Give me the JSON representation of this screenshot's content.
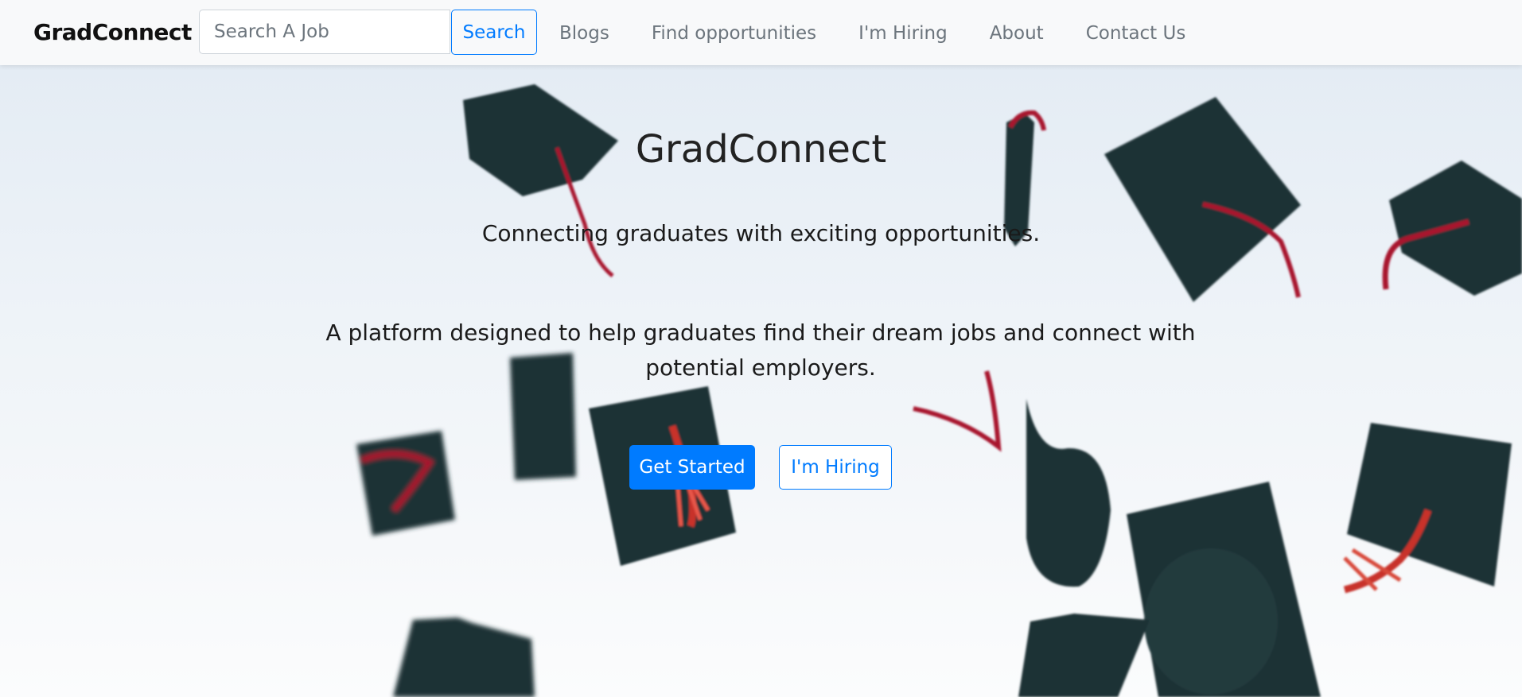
{
  "navbar": {
    "brand": "GradConnect",
    "search_placeholder": "Search A Job",
    "search_button_label": "Search",
    "links": [
      "Blogs",
      "Find opportunities",
      "I'm Hiring",
      "About",
      "Contact Us"
    ]
  },
  "hero": {
    "title": "GradConnect",
    "tagline": "Connecting graduates with exciting opportunities.",
    "description": "A platform designed to help graduates find their dream jobs and connect with potential employers.",
    "primary_button_label": "Get Started",
    "secondary_button_label": "I'm Hiring",
    "background_image": "graduation-caps-thrown-in-air"
  },
  "colors": {
    "accent": "#007bff",
    "navbar_bg": "#f8f9fa",
    "nav_link": "#6c757d",
    "cap": "#1f3135",
    "tassel": "#a8132e"
  }
}
